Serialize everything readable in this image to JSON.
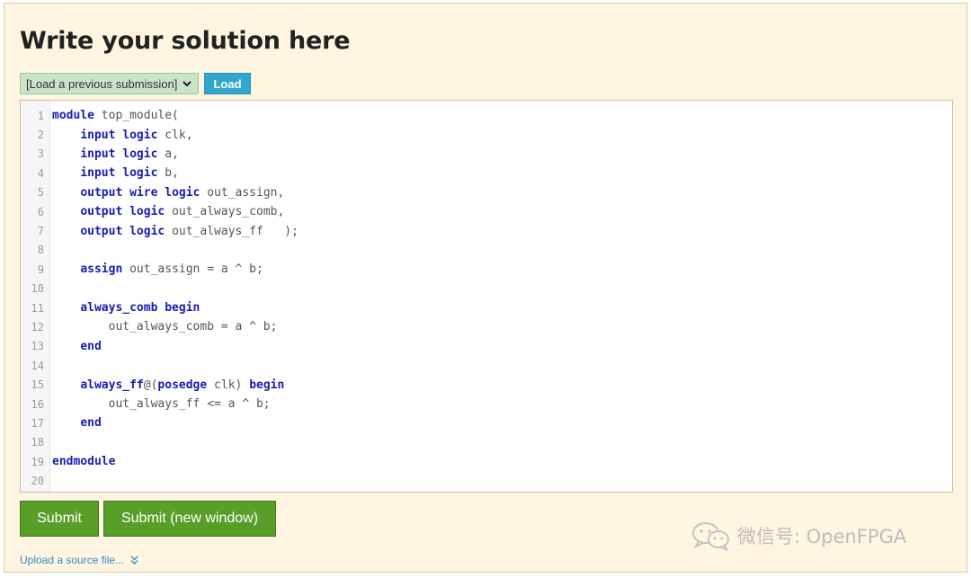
{
  "page": {
    "title": "Write your solution here"
  },
  "load": {
    "select_value": "[Load a previous submission]",
    "button_label": "Load"
  },
  "editor": {
    "lines": [
      {
        "n": "1",
        "indent": "",
        "tokens": [
          [
            "kw",
            "module"
          ],
          [
            "t",
            " top_module("
          ]
        ]
      },
      {
        "n": "2",
        "indent": "    ",
        "tokens": [
          [
            "kw",
            "input"
          ],
          [
            "t",
            " "
          ],
          [
            "kw",
            "logic"
          ],
          [
            "t",
            " clk,"
          ]
        ]
      },
      {
        "n": "3",
        "indent": "    ",
        "tokens": [
          [
            "kw",
            "input"
          ],
          [
            "t",
            " "
          ],
          [
            "kw",
            "logic"
          ],
          [
            "t",
            " a,"
          ]
        ]
      },
      {
        "n": "4",
        "indent": "    ",
        "tokens": [
          [
            "kw",
            "input"
          ],
          [
            "t",
            " "
          ],
          [
            "kw",
            "logic"
          ],
          [
            "t",
            " b,"
          ]
        ]
      },
      {
        "n": "5",
        "indent": "    ",
        "tokens": [
          [
            "kw",
            "output"
          ],
          [
            "t",
            " "
          ],
          [
            "kw",
            "wire"
          ],
          [
            "t",
            " "
          ],
          [
            "kw",
            "logic"
          ],
          [
            "t",
            " out_assign,"
          ]
        ]
      },
      {
        "n": "6",
        "indent": "    ",
        "tokens": [
          [
            "kw",
            "output"
          ],
          [
            "t",
            " "
          ],
          [
            "kw",
            "logic"
          ],
          [
            "t",
            " out_always_comb,"
          ]
        ]
      },
      {
        "n": "7",
        "indent": "    ",
        "tokens": [
          [
            "kw",
            "output"
          ],
          [
            "t",
            " "
          ],
          [
            "kw",
            "logic"
          ],
          [
            "t",
            " out_always_ff   );"
          ]
        ]
      },
      {
        "n": "8",
        "indent": "",
        "tokens": []
      },
      {
        "n": "9",
        "indent": "    ",
        "tokens": [
          [
            "kw",
            "assign"
          ],
          [
            "t",
            " out_assign = a ^ b;"
          ]
        ]
      },
      {
        "n": "10",
        "indent": "",
        "tokens": []
      },
      {
        "n": "11",
        "indent": "    ",
        "tokens": [
          [
            "kw",
            "always_comb"
          ],
          [
            "t",
            " "
          ],
          [
            "kw",
            "begin"
          ]
        ]
      },
      {
        "n": "12",
        "indent": "        ",
        "tokens": [
          [
            "t",
            "out_always_comb = a ^ b;"
          ]
        ]
      },
      {
        "n": "13",
        "indent": "    ",
        "tokens": [
          [
            "kw",
            "end"
          ]
        ]
      },
      {
        "n": "14",
        "indent": "",
        "tokens": []
      },
      {
        "n": "15",
        "indent": "    ",
        "tokens": [
          [
            "kw",
            "always_ff"
          ],
          [
            "t",
            "@("
          ],
          [
            "kw",
            "posedge"
          ],
          [
            "t",
            " clk) "
          ],
          [
            "kw",
            "begin"
          ]
        ]
      },
      {
        "n": "16",
        "indent": "        ",
        "tokens": [
          [
            "t",
            "out_always_ff <= a ^ b;"
          ]
        ]
      },
      {
        "n": "17",
        "indent": "    ",
        "tokens": [
          [
            "kw",
            "end"
          ]
        ]
      },
      {
        "n": "18",
        "indent": "",
        "tokens": []
      },
      {
        "n": "19",
        "indent": "",
        "tokens": [
          [
            "kw",
            "endmodule"
          ]
        ]
      },
      {
        "n": "20",
        "indent": "",
        "tokens": []
      }
    ]
  },
  "actions": {
    "submit_label": "Submit",
    "submit_new_window_label": "Submit (new window)",
    "upload_label": "Upload a source file..."
  },
  "watermark": {
    "text": "微信号: OpenFPGA"
  },
  "colors": {
    "panel_bg": "#fff5e1",
    "keyword": "#1a1ab8",
    "submit_green": "#5a9e2a",
    "load_blue": "#2fa7cf",
    "link_blue": "#2e8bc6"
  }
}
